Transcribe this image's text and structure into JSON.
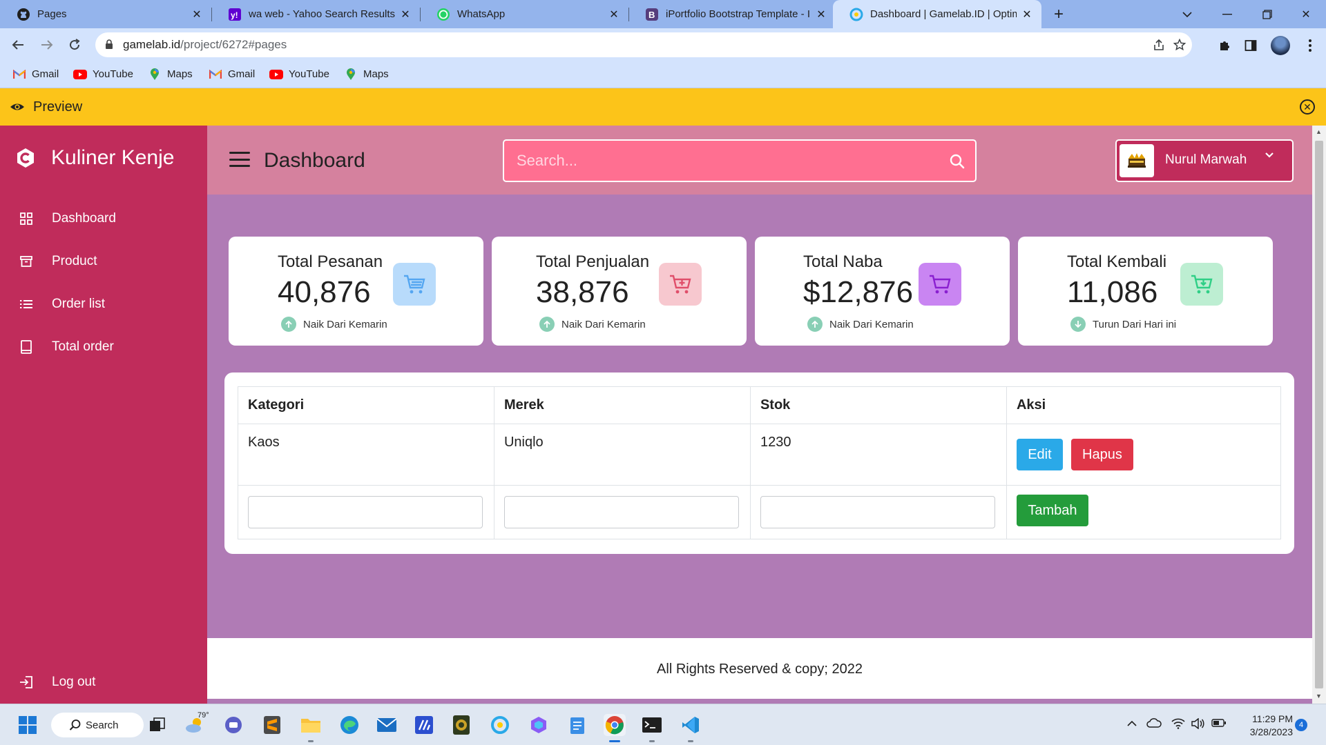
{
  "browser": {
    "tabs": [
      {
        "title": "Pages",
        "icon": "github-icon"
      },
      {
        "title": "wa web - Yahoo Search Results",
        "icon": "yahoo-icon"
      },
      {
        "title": "WhatsApp",
        "icon": "whatsapp-icon"
      },
      {
        "title": "iPortfolio Bootstrap Template - In",
        "icon": "bootstrap-icon"
      },
      {
        "title": "Dashboard | Gamelab.ID | Optimi",
        "icon": "gamelab-icon",
        "active": true
      }
    ],
    "url_host": "gamelab.id",
    "url_path": "/project/6272#pages",
    "bookmarks": [
      {
        "label": "Gmail",
        "icon": "gmail-icon"
      },
      {
        "label": "YouTube",
        "icon": "youtube-icon"
      },
      {
        "label": "Maps",
        "icon": "maps-icon"
      },
      {
        "label": "Gmail",
        "icon": "gmail-icon"
      },
      {
        "label": "YouTube",
        "icon": "youtube-icon"
      },
      {
        "label": "Maps",
        "icon": "maps-icon"
      }
    ]
  },
  "preview_bar": {
    "label": "Preview",
    "color": "#fcc419"
  },
  "sidebar": {
    "brand": "Kuliner Kenje",
    "items": [
      {
        "label": "Dashboard",
        "icon": "grid-icon"
      },
      {
        "label": "Product",
        "icon": "box-icon"
      },
      {
        "label": "Order list",
        "icon": "list-icon"
      },
      {
        "label": "Total order",
        "icon": "tablet-icon"
      }
    ],
    "logout": "Log out",
    "color": "#c02c5b"
  },
  "header": {
    "title": "Dashboard",
    "search_placeholder": "Search...",
    "user_name": "Nurul Marwah"
  },
  "stats": [
    {
      "title": "Total Pesanan",
      "value": "40,876",
      "trend": "Naik Dari Kemarin",
      "icon_color": "#b8dbfb",
      "icon_fg": "#54a6f1",
      "trend_dir": "up"
    },
    {
      "title": "Total Penjualan",
      "value": "38,876",
      "trend": "Naik Dari Kemarin",
      "icon_color": "#f7c8cf",
      "icon_fg": "#e04e6a",
      "trend_dir": "up"
    },
    {
      "title": "Total Naba",
      "value": "$12,876",
      "trend": "Naik Dari Kemarin",
      "icon_color": "#c985f2",
      "icon_fg": "#8a1fd0",
      "trend_dir": "up"
    },
    {
      "title": "Total Kembali",
      "value": "11,086",
      "trend": "Turun Dari Hari ini",
      "icon_color": "#bdeed2",
      "icon_fg": "#2fcf86",
      "trend_dir": "down"
    }
  ],
  "table": {
    "headers": [
      "Kategori",
      "Merek",
      "Stok",
      "Aksi"
    ],
    "rows": [
      {
        "kategori": "Kaos",
        "merek": "Uniqlo",
        "stok": "1230"
      }
    ],
    "edit_label": "Edit",
    "delete_label": "Hapus",
    "add_label": "Tambah"
  },
  "footer": {
    "text": "All Rights Reserved & copy; 2022"
  },
  "taskbar": {
    "search_label": "Search",
    "weather": "79°",
    "time": "11:29 PM",
    "date": "3/28/2023",
    "notifications": "4"
  }
}
